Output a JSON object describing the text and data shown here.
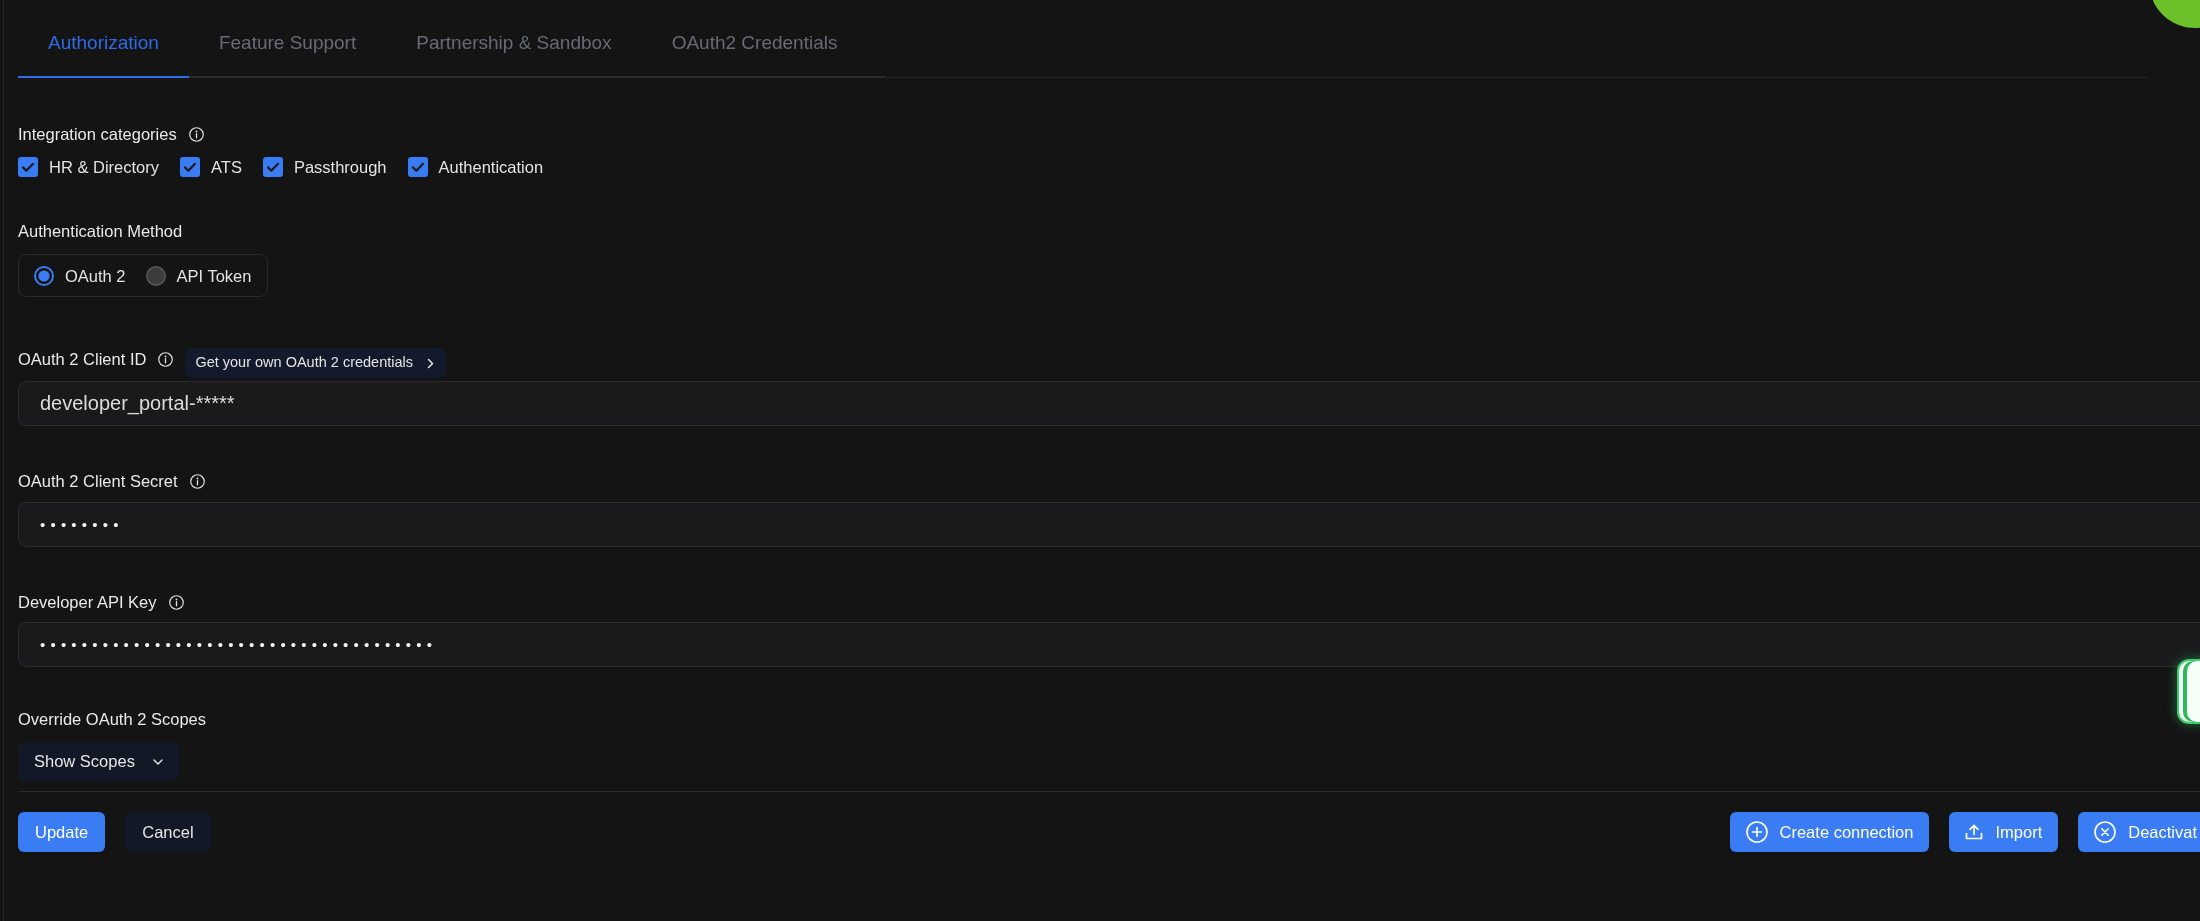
{
  "tabs": [
    {
      "label": "Authorization",
      "selected": true
    },
    {
      "label": "Feature Support",
      "selected": false
    },
    {
      "label": "Partnership & Sandbox",
      "selected": false
    },
    {
      "label": "OAuth2 Credentials",
      "selected": false
    }
  ],
  "integration_categories": {
    "label": "Integration categories",
    "options": [
      {
        "label": "HR & Directory",
        "checked": true
      },
      {
        "label": "ATS",
        "checked": true
      },
      {
        "label": "Passthrough",
        "checked": true
      },
      {
        "label": "Authentication",
        "checked": true
      }
    ]
  },
  "authentication_method": {
    "label": "Authentication Method",
    "options": [
      {
        "label": "OAuth 2",
        "selected": true
      },
      {
        "label": "API Token",
        "selected": false
      }
    ]
  },
  "fields": [
    {
      "label": "OAuth 2 Client ID",
      "kind": "text",
      "value": "developer_portal-*****",
      "link": "Get your own OAuth 2 credentials"
    },
    {
      "label": "OAuth 2 Client Secret",
      "kind": "secret",
      "value": "••••••••"
    },
    {
      "label": "Developer API Key",
      "kind": "secret",
      "value": "••••••••••••••••••••••••••••••••••••••"
    }
  ],
  "scopes": {
    "label": "Override OAuth 2 Scopes",
    "button": "Show Scopes"
  },
  "footer": {
    "left_buttons": [
      {
        "label": "Update",
        "kind": "primary"
      },
      {
        "label": "Cancel",
        "kind": "secondary"
      }
    ],
    "right_buttons": [
      {
        "label": "Create connection"
      },
      {
        "label": "Import"
      },
      {
        "label": "Deactivat"
      }
    ]
  }
}
